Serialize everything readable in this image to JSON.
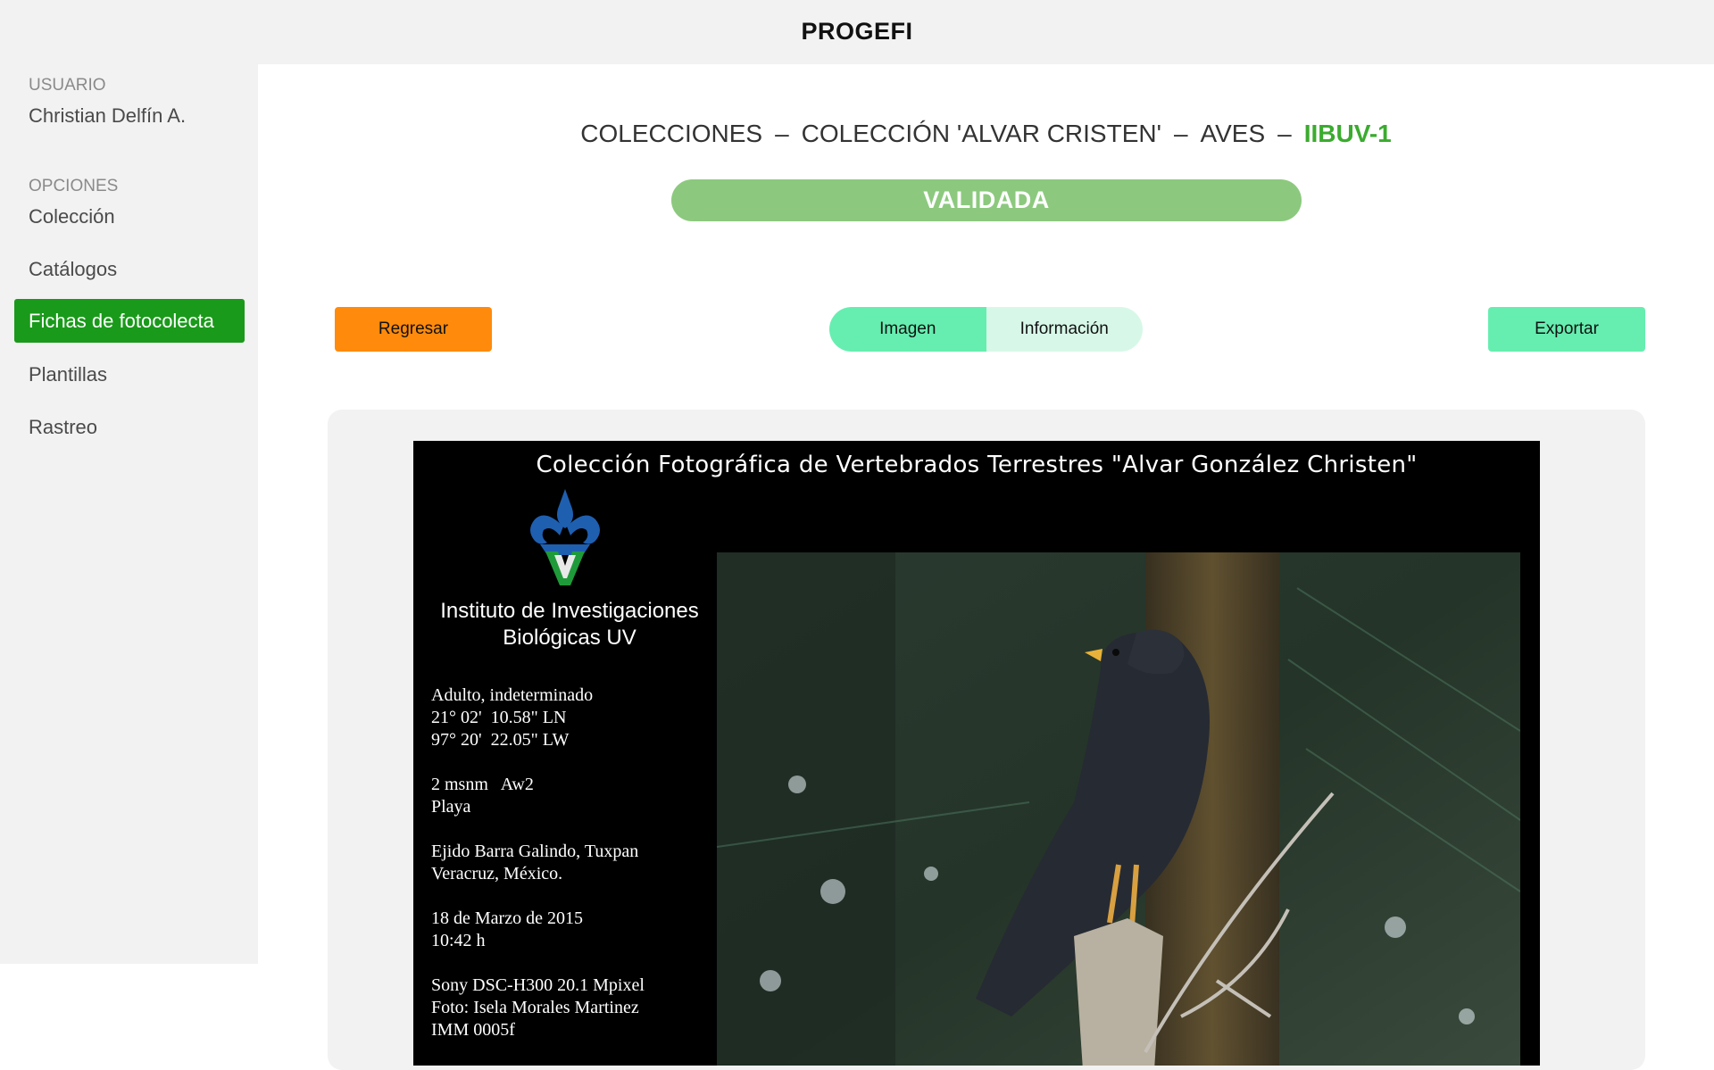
{
  "app": {
    "title": "PROGEFI"
  },
  "sidebar": {
    "user_heading": "USUARIO",
    "user_name": "Christian Delfín A.",
    "options_heading": "OPCIONES",
    "items": [
      {
        "label": "Colección"
      },
      {
        "label": "Catálogos"
      },
      {
        "label": "Fichas de fotocolecta",
        "active": true
      },
      {
        "label": "Plantillas"
      },
      {
        "label": "Rastreo"
      }
    ]
  },
  "breadcrumb": {
    "items": [
      "COLECCIONES",
      "COLECCIÓN 'ALVAR CRISTEN'",
      "AVES"
    ],
    "separator": "–",
    "current": "IIBUV-1"
  },
  "status": {
    "label": "VALIDADA"
  },
  "actions": {
    "back_label": "Regresar",
    "export_label": "Exportar",
    "view_tabs": [
      {
        "label": "Imagen",
        "selected": true
      },
      {
        "label": "Información",
        "selected": false
      }
    ]
  },
  "photo_card": {
    "title": "Colección Fotográfica de Vertebrados Terrestres  \"Alvar González Christen\"",
    "institute_line1": "Instituto de Investigaciones",
    "institute_line2": "Biológicas UV",
    "info": {
      "stage": "Adulto, indeterminado",
      "latitude": "21° 02'  10.58\" LN",
      "longitude": "97° 20'  22.05\" LW",
      "altitude_climate": "2 msnm   Aw2",
      "habitat": "Playa",
      "locality_1": "Ejido Barra Galindo, Tuxpan",
      "locality_2": "Veracruz, México.",
      "date": "18 de Marzo de 2015",
      "time": "10:42 h",
      "camera": "Sony DSC-H300 20.1 Mpixel",
      "photographer": "Foto: Isela Morales Martinez",
      "catalog": "IMM 0005f"
    }
  },
  "colors": {
    "sidebar_active": "#1a9a1a",
    "status_bar": "#8cc97e",
    "breadcrumb_current": "#3bab2f",
    "back_button": "#ff8a0c",
    "export_button": "#66eeb0",
    "tab_selected": "#66eeb0",
    "tab_unselected": "#d7f8e8"
  },
  "icons": {
    "logo": "uv-fleur-de-lis-logo"
  }
}
